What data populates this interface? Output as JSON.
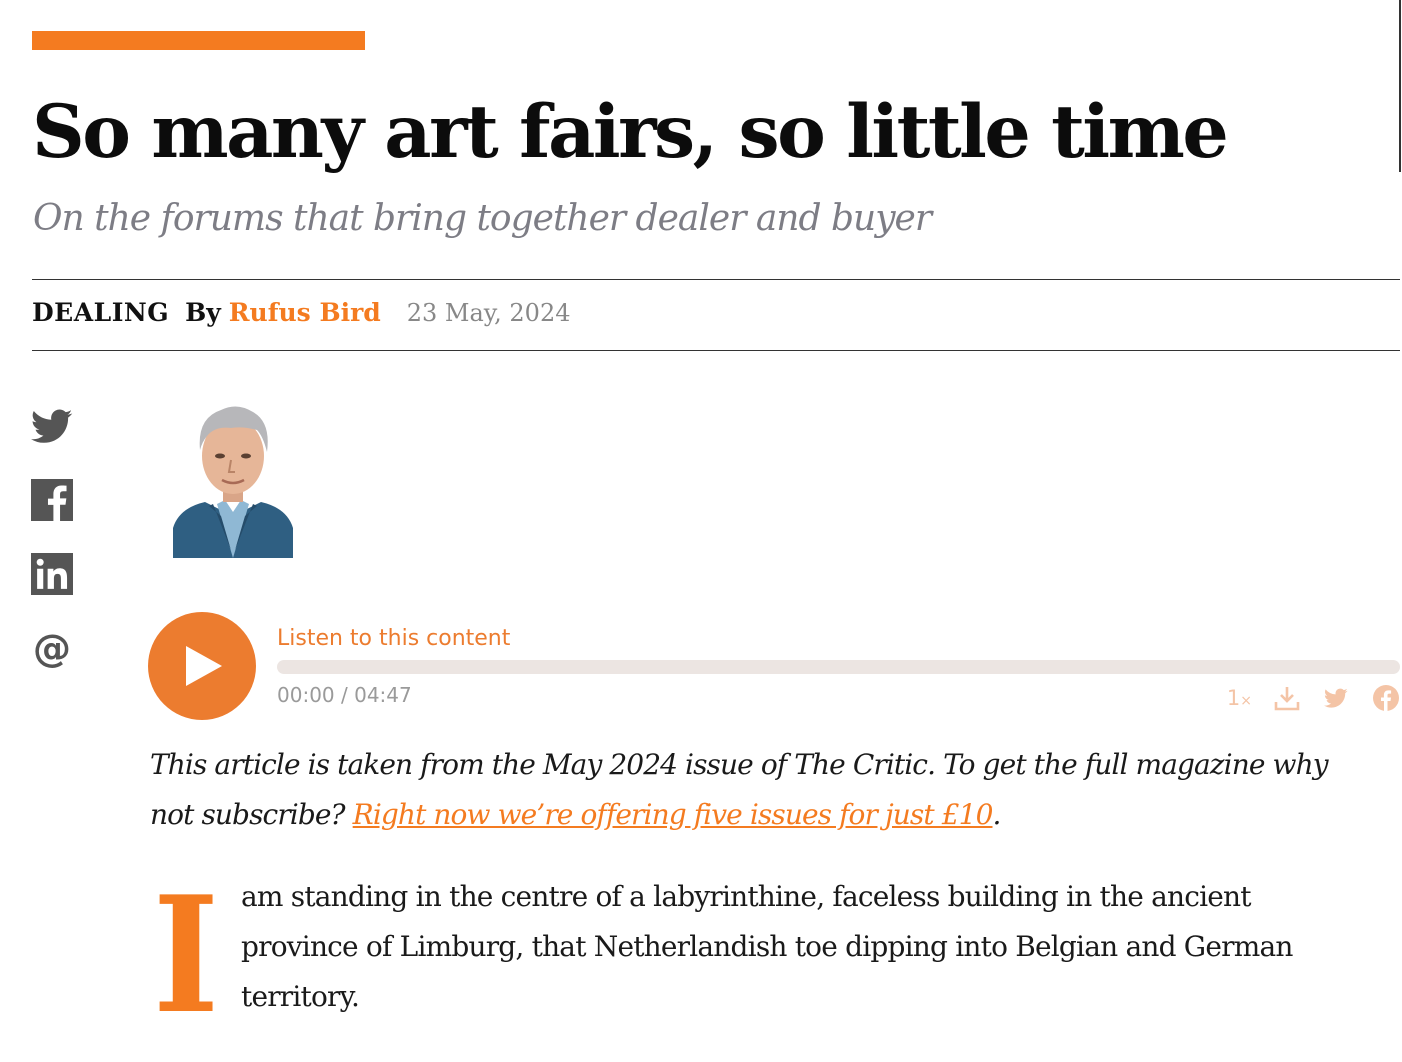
{
  "article": {
    "title": "So many art fairs, so little time",
    "subtitle": "On the forums that bring together dealer and buyer",
    "category": "DEALING",
    "by_label": "By",
    "author": "Rufus Bird",
    "date": "23 May, 2024"
  },
  "share": [
    "twitter-icon",
    "facebook-icon",
    "linkedin-icon",
    "email-icon"
  ],
  "audio_player": {
    "label": "Listen to this content",
    "current_time": "00:00",
    "separator": " / ",
    "duration": "04:47",
    "progress": 0,
    "speed_number": "1",
    "speed_suffix": "×",
    "accent_color": "#ec7c2f"
  },
  "intro": {
    "text": "This article is taken from the May 2024 issue of The Critic. To get the full magazine why not subscribe? ",
    "link_text": "Right now we’re offering five issues for just £10",
    "end": "."
  },
  "body": {
    "dropcap": "I",
    "text": "am standing in the centre of a labyrinthine, faceless building in the ancient province of Limburg, that Netherlandish toe dipping into Belgian and German territory."
  },
  "colors": {
    "accent": "#f47b20",
    "muted": "#7d7d85"
  }
}
